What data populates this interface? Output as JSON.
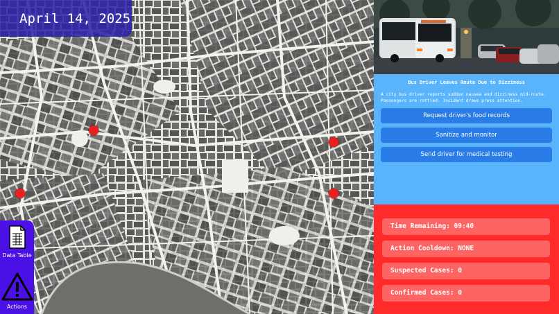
{
  "date": "April 14, 2025",
  "map": {
    "markers": [
      {
        "id": "m1",
        "nx": 0.252,
        "ny": 0.415
      },
      {
        "id": "m2",
        "nx": 0.054,
        "ny": 0.615
      },
      {
        "id": "m3",
        "nx": 0.892,
        "ny": 0.452
      },
      {
        "id": "m4",
        "nx": 0.892,
        "ny": 0.615
      }
    ]
  },
  "toolbar": {
    "data_table_label": "Data Table",
    "actions_label": "Actions"
  },
  "news": {
    "title": "Bus Driver Leaves Route Due to Dizziness",
    "body": "A city bus driver reports sudden nausea and dizziness mid-route. Passengers are rattled. Incident draws press attention.",
    "actions": [
      "Request driver's food records",
      "Sanitize and monitor",
      "Send driver for medical testing"
    ]
  },
  "stats": {
    "time_remaining": "Time Remaining: 09:40",
    "action_cooldown": "Action Cooldown: NONE",
    "suspected_cases": "Suspected Cases: 0",
    "confirmed_cases": "Confirmed Cases: 0"
  },
  "colors": {
    "date_panel": "#2d23aa",
    "toolbar": "#4a10e6",
    "news_bg": "#5ab4fb",
    "button": "#2a7de6",
    "stats_bg": "#ff2a2a",
    "stat_box": "#ff6464",
    "marker": "#e8201f"
  }
}
